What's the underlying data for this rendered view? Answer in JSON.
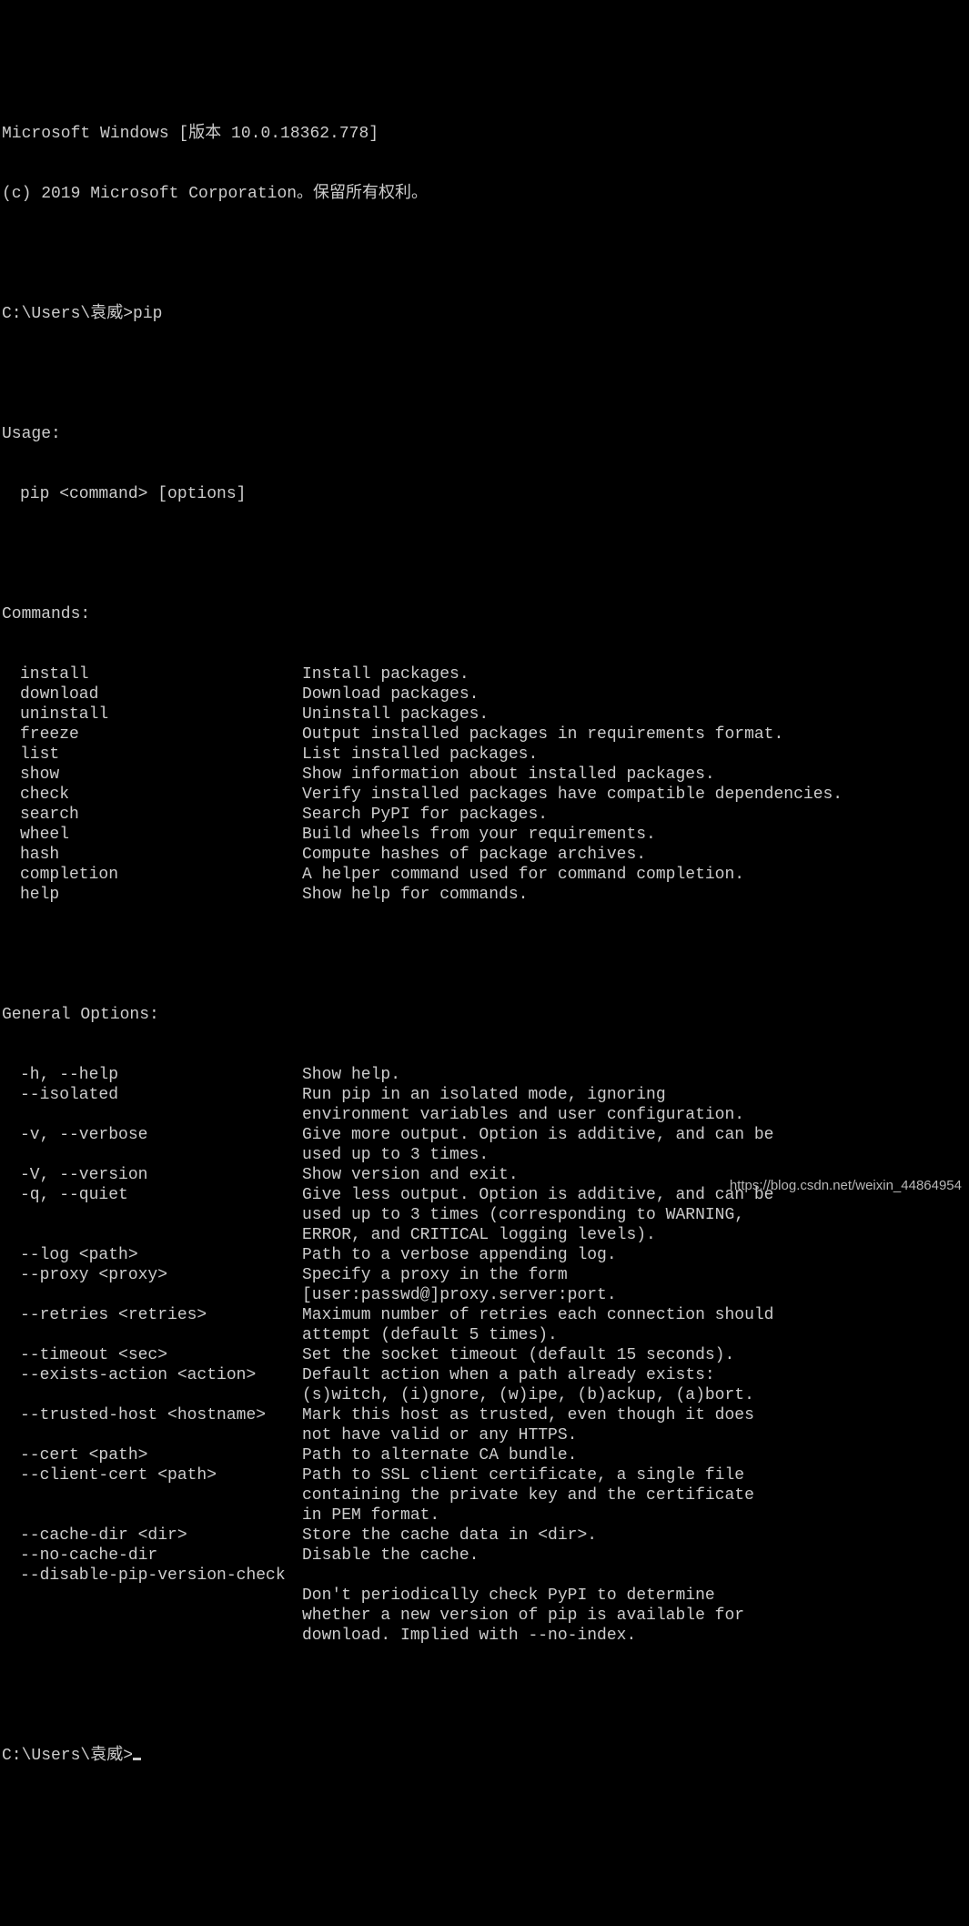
{
  "header": {
    "line1": "Microsoft Windows [版本 10.0.18362.778]",
    "line2": "(c) 2019 Microsoft Corporation。保留所有权利。"
  },
  "prompt1": "C:\\Users\\袁威>pip",
  "prompt2": "C:\\Users\\袁威>",
  "usage": {
    "header": "Usage:",
    "line": "pip <command> [options]"
  },
  "commands": {
    "header": "Commands:",
    "items": [
      {
        "name": "install",
        "desc": "Install packages."
      },
      {
        "name": "download",
        "desc": "Download packages."
      },
      {
        "name": "uninstall",
        "desc": "Uninstall packages."
      },
      {
        "name": "freeze",
        "desc": "Output installed packages in requirements format."
      },
      {
        "name": "list",
        "desc": "List installed packages."
      },
      {
        "name": "show",
        "desc": "Show information about installed packages."
      },
      {
        "name": "check",
        "desc": "Verify installed packages have compatible dependencies."
      },
      {
        "name": "search",
        "desc": "Search PyPI for packages."
      },
      {
        "name": "wheel",
        "desc": "Build wheels from your requirements."
      },
      {
        "name": "hash",
        "desc": "Compute hashes of package archives."
      },
      {
        "name": "completion",
        "desc": "A helper command used for command completion."
      },
      {
        "name": "help",
        "desc": "Show help for commands."
      }
    ]
  },
  "general": {
    "header": "General Options:",
    "items": [
      {
        "name": "-h, --help",
        "desc": [
          "Show help."
        ]
      },
      {
        "name": "--isolated",
        "desc": [
          "Run pip in an isolated mode, ignoring",
          "environment variables and user configuration."
        ]
      },
      {
        "name": "-v, --verbose",
        "desc": [
          "Give more output. Option is additive, and can be",
          "used up to 3 times."
        ]
      },
      {
        "name": "-V, --version",
        "desc": [
          "Show version and exit."
        ]
      },
      {
        "name": "-q, --quiet",
        "desc": [
          "Give less output. Option is additive, and can be",
          "used up to 3 times (corresponding to WARNING,",
          "ERROR, and CRITICAL logging levels)."
        ]
      },
      {
        "name": "--log <path>",
        "desc": [
          "Path to a verbose appending log."
        ]
      },
      {
        "name": "--proxy <proxy>",
        "desc": [
          "Specify a proxy in the form",
          "[user:passwd@]proxy.server:port."
        ]
      },
      {
        "name": "--retries <retries>",
        "desc": [
          "Maximum number of retries each connection should",
          "attempt (default 5 times)."
        ]
      },
      {
        "name": "--timeout <sec>",
        "desc": [
          "Set the socket timeout (default 15 seconds)."
        ]
      },
      {
        "name": "--exists-action <action>",
        "desc": [
          "Default action when a path already exists:",
          "(s)witch, (i)gnore, (w)ipe, (b)ackup, (a)bort."
        ]
      },
      {
        "name": "--trusted-host <hostname>",
        "desc": [
          "Mark this host as trusted, even though it does",
          "not have valid or any HTTPS."
        ]
      },
      {
        "name": "--cert <path>",
        "desc": [
          "Path to alternate CA bundle."
        ]
      },
      {
        "name": "--client-cert <path>",
        "desc": [
          "Path to SSL client certificate, a single file",
          "containing the private key and the certificate",
          "in PEM format."
        ]
      },
      {
        "name": "--cache-dir <dir>",
        "desc": [
          "Store the cache data in <dir>."
        ]
      },
      {
        "name": "--no-cache-dir",
        "desc": [
          "Disable the cache."
        ]
      },
      {
        "name": "--disable-pip-version-check",
        "desc": [
          "",
          "Don't periodically check PyPI to determine",
          "whether a new version of pip is available for",
          "download. Implied with --no-index."
        ]
      }
    ]
  },
  "watermark": "https://blog.csdn.net/weixin_44864954"
}
